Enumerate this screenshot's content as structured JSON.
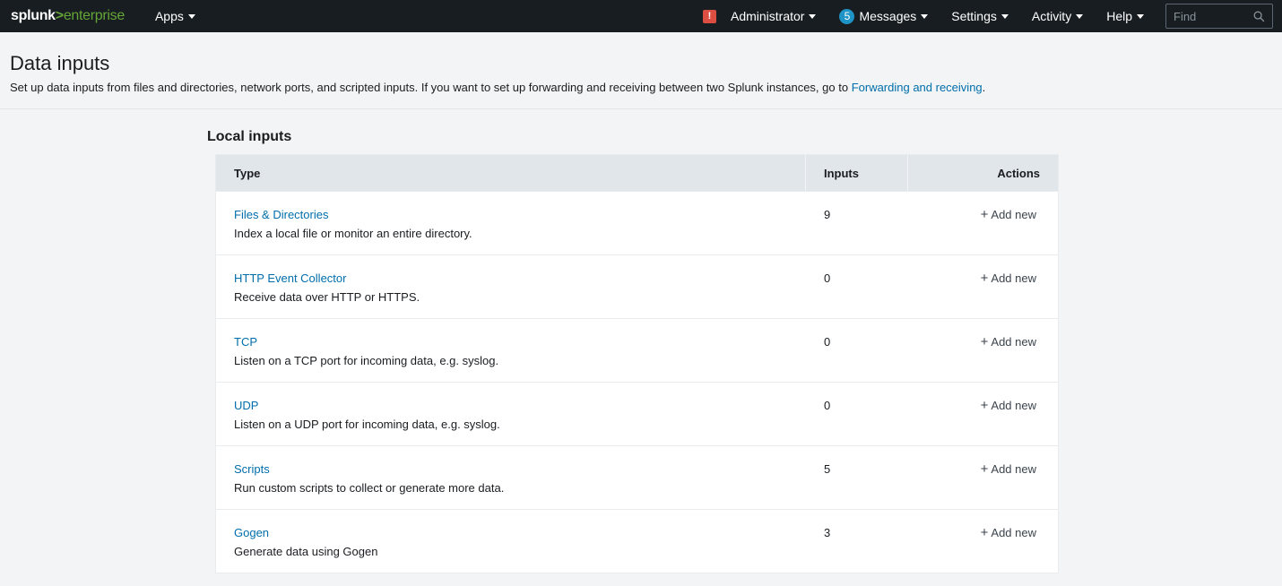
{
  "topbar": {
    "logo": {
      "part1": "splunk",
      "part2": ">",
      "part3": "enterprise"
    },
    "apps_label": "Apps",
    "alert_icon": "!",
    "admin_label": "Administrator",
    "messages_count": "5",
    "messages_label": "Messages",
    "settings_label": "Settings",
    "activity_label": "Activity",
    "help_label": "Help",
    "find_placeholder": "Find"
  },
  "header": {
    "title": "Data inputs",
    "description": "Set up data inputs from files and directories, network ports, and scripted inputs. If you want to set up forwarding and receiving between two Splunk instances, go to ",
    "link_text": "Forwarding and receiving",
    "description_end": "."
  },
  "section": {
    "title": "Local inputs",
    "columns": {
      "type": "Type",
      "inputs": "Inputs",
      "actions": "Actions"
    },
    "rows": [
      {
        "name": "Files & Directories",
        "desc": "Index a local file or monitor an entire directory.",
        "inputs": "9",
        "action": "Add new"
      },
      {
        "name": "HTTP Event Collector",
        "desc": "Receive data over HTTP or HTTPS.",
        "inputs": "0",
        "action": "Add new"
      },
      {
        "name": "TCP",
        "desc": "Listen on a TCP port for incoming data, e.g. syslog.",
        "inputs": "0",
        "action": "Add new"
      },
      {
        "name": "UDP",
        "desc": "Listen on a UDP port for incoming data, e.g. syslog.",
        "inputs": "0",
        "action": "Add new"
      },
      {
        "name": "Scripts",
        "desc": "Run custom scripts to collect or generate more data.",
        "inputs": "5",
        "action": "Add new"
      },
      {
        "name": "Gogen",
        "desc": "Generate data using Gogen",
        "inputs": "3",
        "action": "Add new"
      }
    ]
  },
  "colors": {
    "topbar_bg": "#171d21",
    "brand_green": "#65a637",
    "link_blue": "#006eaa",
    "alert_red": "#dc4e41",
    "badge_blue": "#1e93c6",
    "page_bg": "#f2f4f5"
  }
}
